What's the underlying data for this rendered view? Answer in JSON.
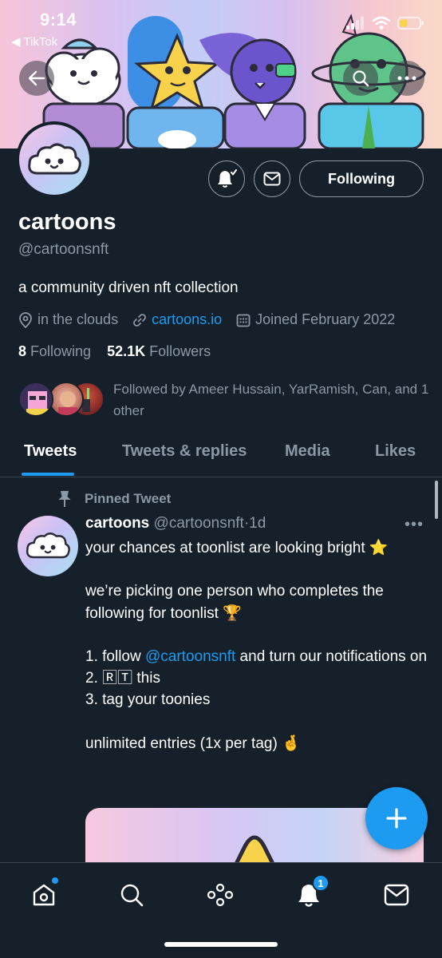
{
  "status_bar": {
    "time": "9:14",
    "back_app": "◀ TikTok"
  },
  "banner": {
    "back_icon": "arrow-left-icon",
    "search_icon": "search-icon",
    "more_icon": "more-horizontal-icon"
  },
  "profile": {
    "display_name": "cartoons",
    "handle": "@cartoonsnft",
    "bio": "a community driven nft collection",
    "location": "in the clouds",
    "website": "cartoons.io",
    "joined": "Joined February 2022",
    "following_count": "8",
    "following_label": "Following",
    "followers_count": "52.1K",
    "followers_label": "Followers",
    "followed_by_text": "Followed by Ameer Hussain, YarRamish, Can, and 1 other",
    "following_button": "Following",
    "notify_icon": "bell-check-icon",
    "message_icon": "envelope-icon"
  },
  "tabs": [
    {
      "label": "Tweets",
      "active": true
    },
    {
      "label": "Tweets & replies",
      "active": false
    },
    {
      "label": "Media",
      "active": false
    },
    {
      "label": "Likes",
      "active": false
    }
  ],
  "tweet": {
    "pinned_label": "Pinned Tweet",
    "author_name": "cartoons",
    "author_handle": "@cartoonsnft",
    "separator": "·",
    "time": "1d",
    "more": "•••",
    "line1": "your chances at toonlist are looking bright ⭐",
    "line2": "we’re picking one person who completes the following for toonlist 🏆",
    "item1_prefix": "1. follow ",
    "item1_mention": "@cartoonsnft",
    "item1_suffix": " and turn our notifications on",
    "item2": "2. 🅁🅃 this",
    "item3": "3. tag your toonies",
    "line4": "unlimited entries (1x per tag) 🤞"
  },
  "fab": {
    "icon": "compose-plus-icon"
  },
  "bottom_nav": {
    "items": [
      "home-icon",
      "search-icon",
      "spaces-icon",
      "notifications-icon",
      "messages-icon"
    ],
    "notification_badge": "1"
  },
  "colors": {
    "background": "#15202b",
    "accent": "#1d9bf0",
    "secondary_text": "#8b98a5",
    "divider": "#38444d"
  }
}
